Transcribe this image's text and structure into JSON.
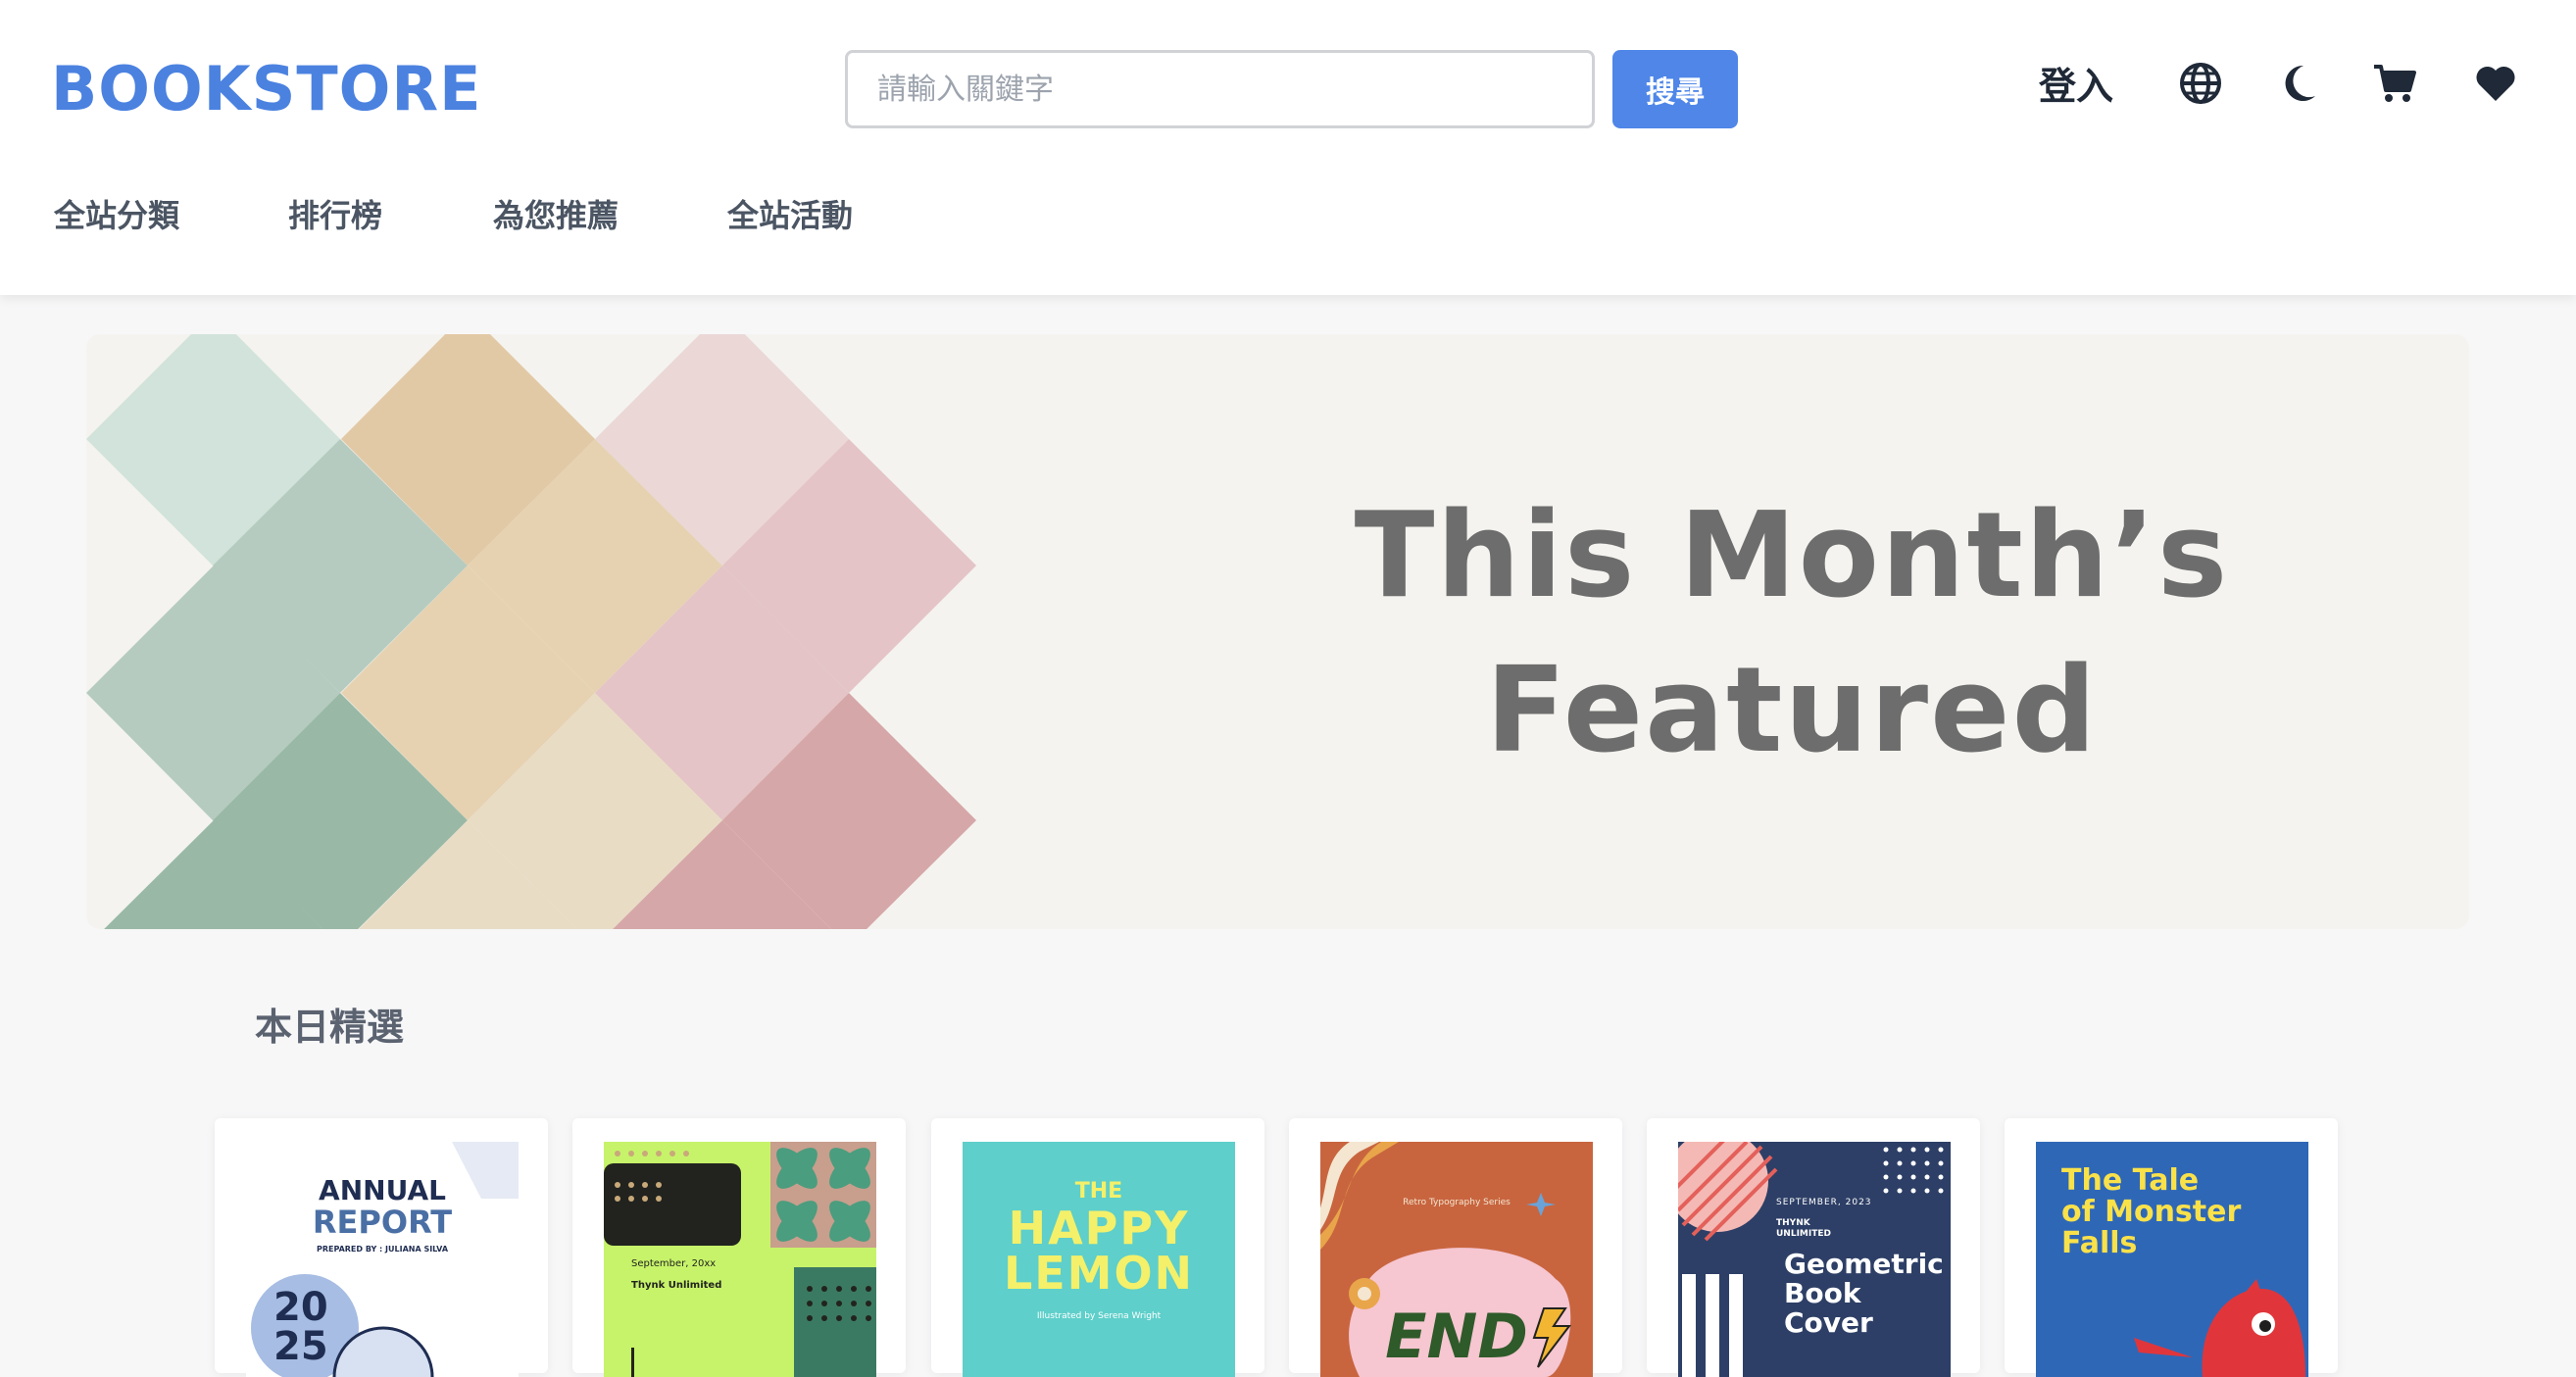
{
  "header": {
    "logo": "BOOKSTORE",
    "search": {
      "placeholder": "請輸入關鍵字",
      "value": ""
    },
    "search_button": "搜尋",
    "login": "登入",
    "icons": [
      "globe-icon",
      "moon-icon",
      "cart-icon",
      "heart-icon"
    ]
  },
  "nav": {
    "items": [
      {
        "label": "全站分類"
      },
      {
        "label": "排行榜"
      },
      {
        "label": "為您推薦"
      },
      {
        "label": "全站活動"
      }
    ]
  },
  "banner": {
    "line1": "This Month’s",
    "line2": "Featured"
  },
  "featured": {
    "title": "本日精選",
    "books": [
      {
        "cover_title": "ANNUAL",
        "cover_title2": "REPORT",
        "cover_sub": "PREPARED BY : JULIANA SILVA",
        "cover_num": "20",
        "cover_num2": "25"
      },
      {
        "cover_date": "September, 20xx",
        "cover_author": "Thynk Unlimited"
      },
      {
        "cover_title": "THE",
        "cover_title2": "HAPPY",
        "cover_title3": "LEMON",
        "cover_sub": "Illustrated by Serena Wright"
      },
      {
        "cover_series": "Retro Typography Series",
        "cover_title": "END"
      },
      {
        "cover_date": "SEPTEMBER, 2023",
        "cover_pub": "THYNK",
        "cover_pub2": "UNLIMITED",
        "cover_title": "Geometric",
        "cover_title2": "Book",
        "cover_title3": "Cover"
      },
      {
        "cover_title": "The Tale",
        "cover_title2": "of Monster",
        "cover_title3": "Falls"
      }
    ]
  },
  "colors": {
    "brand": "#4b82e0",
    "search_button": "#4f86e8",
    "banner_bg": "#f4f3ef"
  }
}
